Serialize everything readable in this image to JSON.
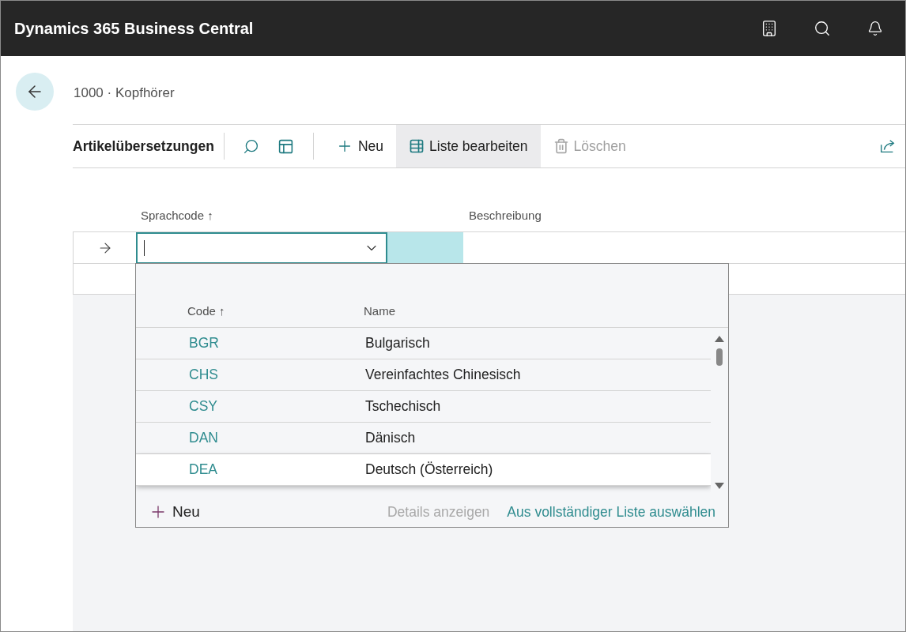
{
  "header": {
    "title": "Dynamics 365 Business Central"
  },
  "breadcrumb": "1000 · Kopfhörer",
  "action_bar": {
    "title": "Artikelübersetzungen",
    "actions": [
      {
        "label": "Neu",
        "kind": "new",
        "disabled": false,
        "selected": false
      },
      {
        "label": "Liste bearbeiten",
        "kind": "edit",
        "disabled": false,
        "selected": true
      },
      {
        "label": "Löschen",
        "kind": "delete",
        "disabled": true,
        "selected": false
      }
    ]
  },
  "grid": {
    "columns": [
      {
        "label": "Sprachcode",
        "sort": "↑"
      },
      {
        "label": "Beschreibung"
      }
    ]
  },
  "dropdown": {
    "columns": [
      {
        "label": "Code",
        "sort": "↑"
      },
      {
        "label": "Name"
      }
    ],
    "rows": [
      {
        "code": "BGR",
        "name": "Bulgarisch",
        "selected": false
      },
      {
        "code": "CHS",
        "name": "Vereinfachtes Chinesisch",
        "selected": false
      },
      {
        "code": "CSY",
        "name": "Tschechisch",
        "selected": false
      },
      {
        "code": "DAN",
        "name": "Dänisch",
        "selected": false
      },
      {
        "code": "DEA",
        "name": "Deutsch (Österreich)",
        "selected": true
      }
    ],
    "footer": {
      "new": "Neu",
      "details": {
        "label": "Details anzeigen",
        "disabled": true
      },
      "select_all": "Aus vollständiger Liste auswählen"
    }
  }
}
